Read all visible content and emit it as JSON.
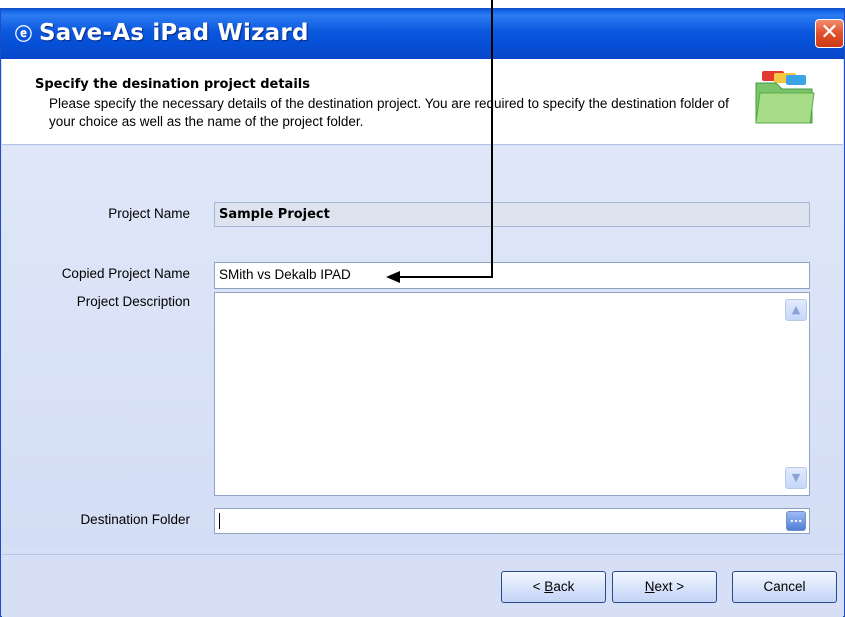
{
  "window": {
    "title": "Save-As iPad Wizard",
    "close_symbol": "✕"
  },
  "header": {
    "title": "Specify the desination project details",
    "description": "Please specify the necessary details of the destination project. You are required to specify the destination folder of your choice as well as the name of the project folder.",
    "icon": "folder-icon"
  },
  "form": {
    "project_name_label": "Project Name",
    "project_name_value": "Sample Project",
    "copied_name_label": "Copied Project Name",
    "copied_name_value": "SMith vs Dekalb IPAD",
    "description_label": "Project Description",
    "description_value": "",
    "destination_label": "Destination Folder",
    "destination_value": "",
    "browse_symbol": "..."
  },
  "buttons": {
    "back_prefix": "< ",
    "back_mnemonic": "B",
    "back_rest": "ack",
    "next_mnemonic": "N",
    "next_rest": "ext >",
    "cancel": "Cancel"
  },
  "colors": {
    "titlebar": "#0550d6",
    "body": "#d6dff5",
    "close": "#e0502c",
    "annotation": "#000000"
  }
}
